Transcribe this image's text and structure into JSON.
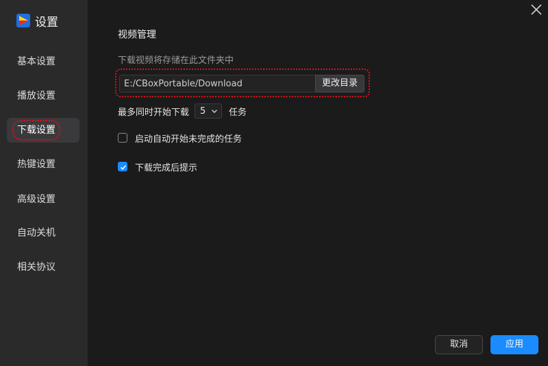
{
  "window": {
    "title": "设置",
    "close_icon": "close-icon"
  },
  "sidebar": {
    "items": [
      {
        "label": "基本设置",
        "active": false
      },
      {
        "label": "播放设置",
        "active": false
      },
      {
        "label": "下载设置",
        "active": true
      },
      {
        "label": "热键设置",
        "active": false
      },
      {
        "label": "高级设置",
        "active": false
      },
      {
        "label": "自动关机",
        "active": false
      },
      {
        "label": "相关协议",
        "active": false
      }
    ]
  },
  "download": {
    "section_title": "视频管理",
    "path_caption": "下载视频将存储在此文件夹中",
    "path_value": "E:/CBoxPortable/Download",
    "change_dir_label": "更改目录",
    "limit_prefix": "最多同时开始下载",
    "limit_value": "5",
    "limit_suffix": "任务",
    "auto_start_label": "启动自动开始未完成的任务",
    "auto_start_checked": false,
    "notify_label": "下载完成后提示",
    "notify_checked": true
  },
  "footer": {
    "cancel_label": "取消",
    "apply_label": "应用"
  },
  "colors": {
    "accent": "#1a8cff",
    "highlight": "#e0101a",
    "sidebar_bg": "#2a2a2b",
    "main_bg": "#1b1b1c"
  }
}
